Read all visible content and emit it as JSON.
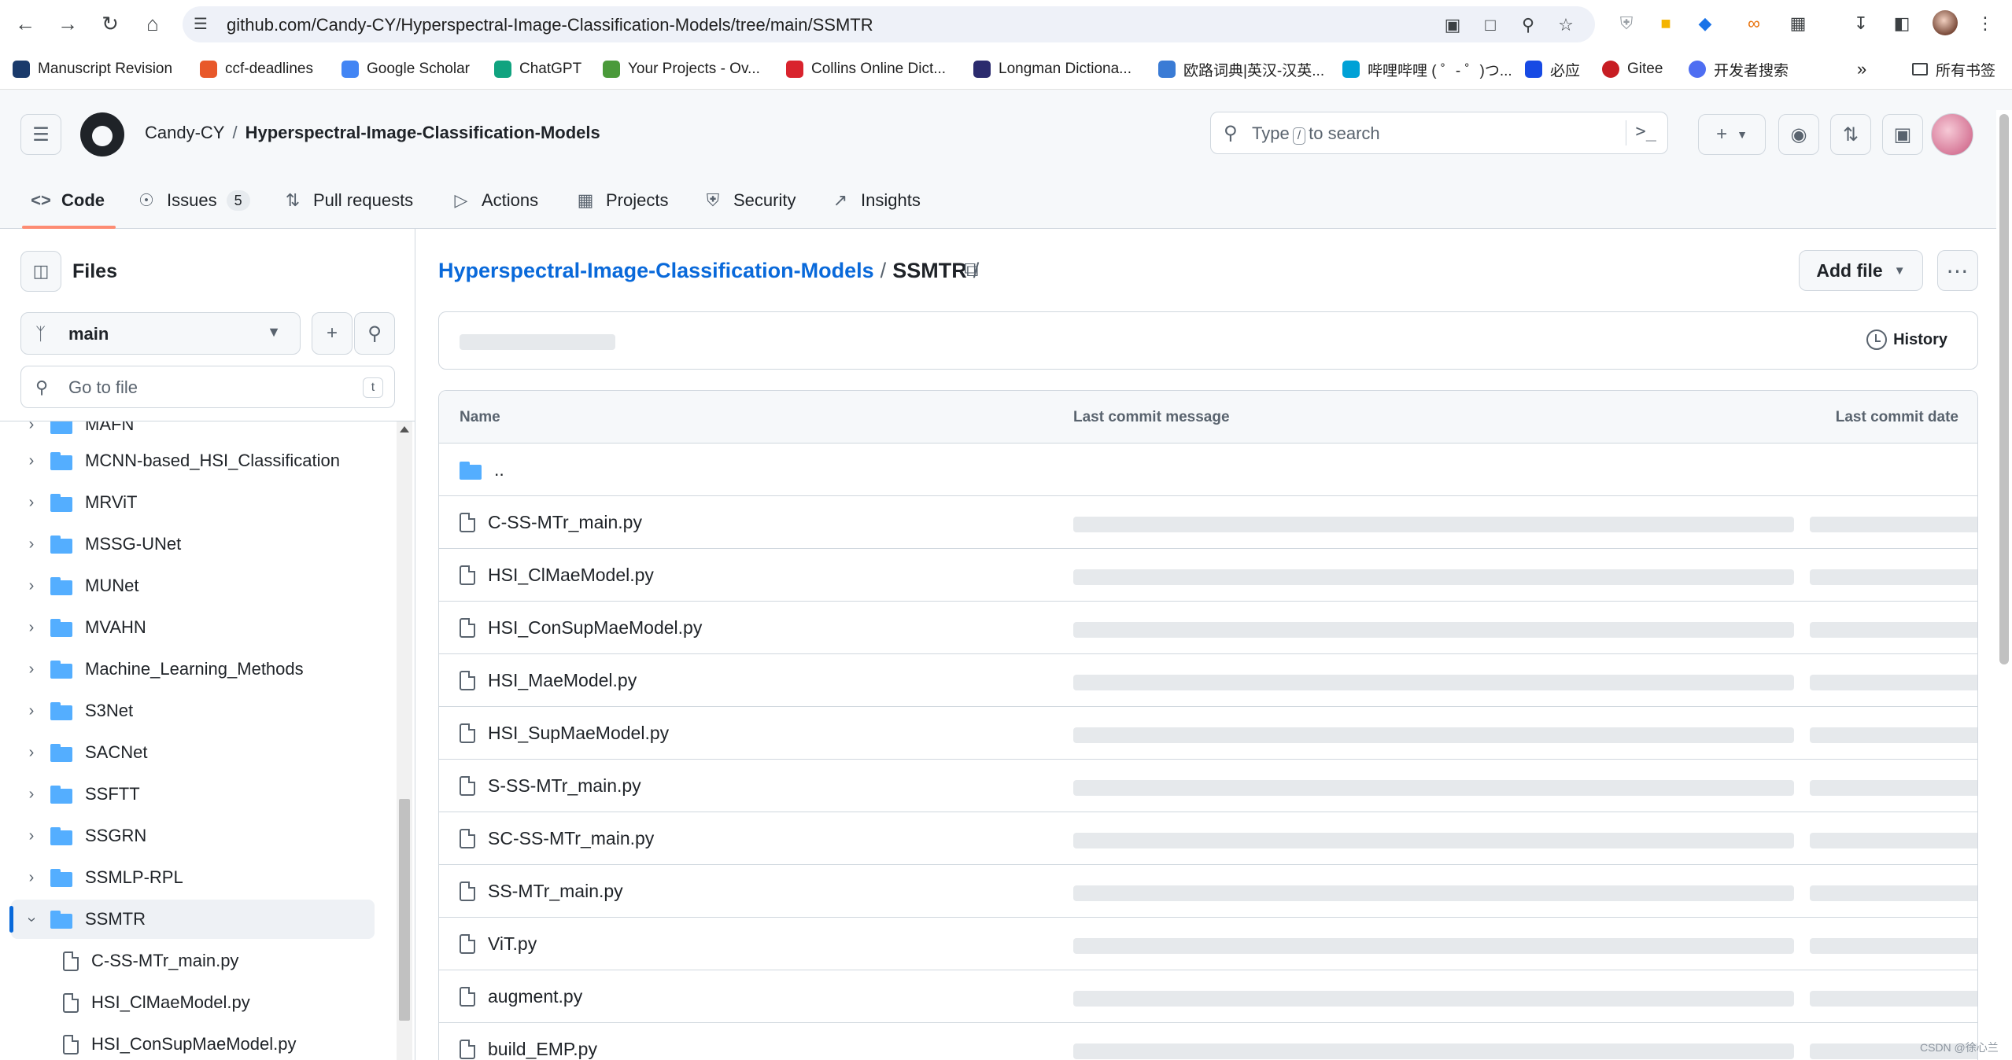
{
  "browser": {
    "url": "github.com/Candy-CY/Hyperspectral-Image-Classification-Models/tree/main/SSMTR",
    "bookmarks": [
      {
        "label": "Manuscript Revision",
        "color": "#1a3a6b"
      },
      {
        "label": "ccf-deadlines",
        "color": "#e8582a"
      },
      {
        "label": "Google Scholar",
        "color": "#4285f4"
      },
      {
        "label": "ChatGPT",
        "color": "#10a37f"
      },
      {
        "label": "Your Projects - Ov...",
        "color": "#4a9a3a"
      },
      {
        "label": "Collins Online Dict...",
        "color": "#d9232d"
      },
      {
        "label": "Longman Dictiona...",
        "color": "#2b2b6e"
      },
      {
        "label": "欧路词典|英汉-汉英...",
        "color": "#3a7bd5"
      },
      {
        "label": "哔哩哔哩 ( ゜- ゜)つ...",
        "color": "#00a1d6"
      },
      {
        "label": "必应",
        "color": "#174ae4"
      },
      {
        "label": "Gitee",
        "color": "#c71d23"
      },
      {
        "label": "开发者搜索",
        "color": "#4e6ef2"
      }
    ],
    "all_bookmarks": "所有书签"
  },
  "header": {
    "owner": "Candy-CY",
    "repo": "Hyperspectral-Image-Classification-Models",
    "search_prefix": "Type",
    "search_key": "/",
    "search_suffix": "to search"
  },
  "tabs": [
    {
      "label": "Code",
      "icon": "code-icon",
      "active": true
    },
    {
      "label": "Issues",
      "icon": "issue-icon",
      "count": "5"
    },
    {
      "label": "Pull requests",
      "icon": "pull-request-icon"
    },
    {
      "label": "Actions",
      "icon": "play-icon"
    },
    {
      "label": "Projects",
      "icon": "table-icon"
    },
    {
      "label": "Security",
      "icon": "shield-icon"
    },
    {
      "label": "Insights",
      "icon": "graph-icon"
    }
  ],
  "sidebar": {
    "title": "Files",
    "branch": "main",
    "goto_placeholder": "Go to file",
    "goto_key": "t",
    "folders": [
      "MAFN",
      "MCNN-based_HSI_Classification",
      "MRViT",
      "MSSG-UNet",
      "MUNet",
      "MVAHN",
      "Machine_Learning_Methods",
      "S3Net",
      "SACNet",
      "SSFTT",
      "SSGRN",
      "SSMLP-RPL",
      "SSMTR"
    ],
    "selected_folder": "SSMTR",
    "children": [
      "C-SS-MTr_main.py",
      "HSI_ClMaeModel.py",
      "HSI_ConSupMaeModel.py"
    ]
  },
  "main": {
    "path_root": "Hyperspectral-Image-Classification-Models",
    "path_current": "SSMTR",
    "add_file": "Add file",
    "history": "History",
    "columns": {
      "name": "Name",
      "message": "Last commit message",
      "date": "Last commit date"
    },
    "parent": "..",
    "files": [
      "C-SS-MTr_main.py",
      "HSI_ClMaeModel.py",
      "HSI_ConSupMaeModel.py",
      "HSI_MaeModel.py",
      "HSI_SupMaeModel.py",
      "S-SS-MTr_main.py",
      "SC-SS-MTr_main.py",
      "SS-MTr_main.py",
      "ViT.py",
      "augment.py",
      "build_EMP.py"
    ]
  },
  "watermark": "CSDN @徐心兰"
}
